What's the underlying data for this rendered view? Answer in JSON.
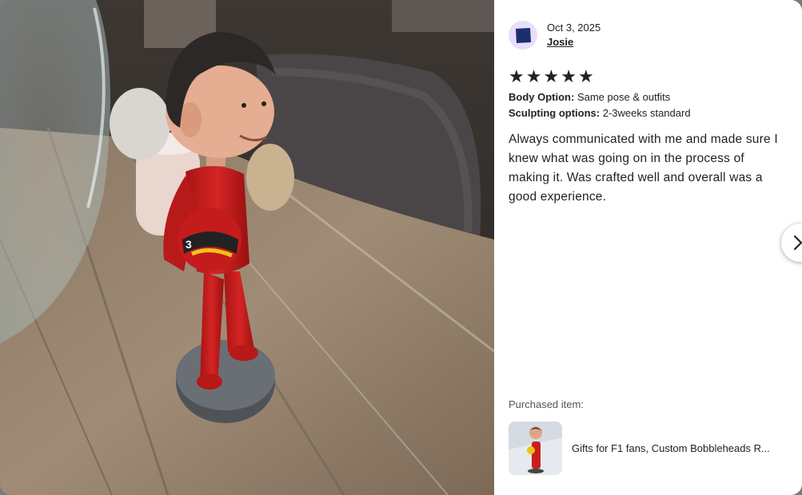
{
  "review": {
    "date": "Oct 3, 2025",
    "reviewer": "Josie",
    "rating": 5,
    "stars": [
      "★",
      "★",
      "★",
      "★",
      "★"
    ],
    "options": [
      {
        "label": "Body Option:",
        "value": "Same pose & outfits"
      },
      {
        "label": "Sculpting options:",
        "value": "2-3weeks standard"
      }
    ],
    "text": "Always communicated with me and made sure I knew what was going on in the process of making it. Was crafted well and overall was a good experience."
  },
  "purchased": {
    "label": "Purchased item:",
    "title": "Gifts for F1 fans, Custom Bobbleheads R..."
  },
  "colors": {
    "avatar_bg": "#e8defb",
    "avatar_icon": "#1b2f6e",
    "suit_red": "#c81e1e"
  },
  "icons": {
    "next": "chevron-right-icon",
    "avatar": "user-avatar-icon"
  }
}
